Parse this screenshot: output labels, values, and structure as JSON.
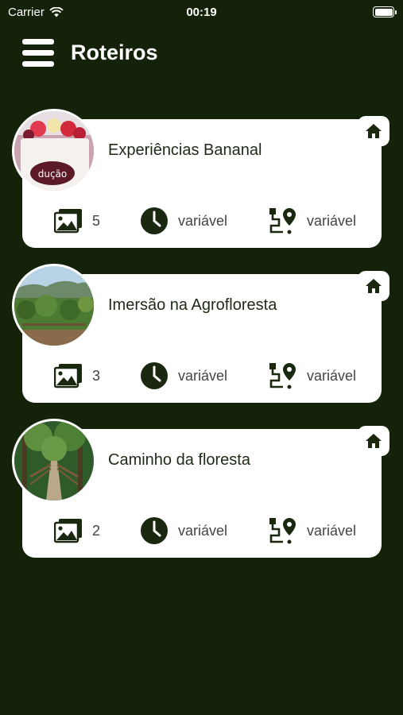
{
  "status": {
    "carrier": "Carrier",
    "time": "00:19"
  },
  "header": {
    "title": "Roteiros"
  },
  "routes": [
    {
      "title": "Experiências Bananal",
      "photos": "5",
      "duration": "variável",
      "distance": "variável"
    },
    {
      "title": "Imersão na Agrofloresta",
      "photos": "3",
      "duration": "variável",
      "distance": "variável"
    },
    {
      "title": "Caminho da floresta",
      "photos": "2",
      "duration": "variável",
      "distance": "variável"
    }
  ],
  "colors": {
    "background": "#132209",
    "card": "#ffffff",
    "icon": "#1a2810"
  },
  "icons": {
    "menu": "hamburger-icon",
    "home": "home-icon",
    "photos": "image-gallery-icon",
    "time": "clock-icon",
    "route": "route-pin-icon"
  }
}
